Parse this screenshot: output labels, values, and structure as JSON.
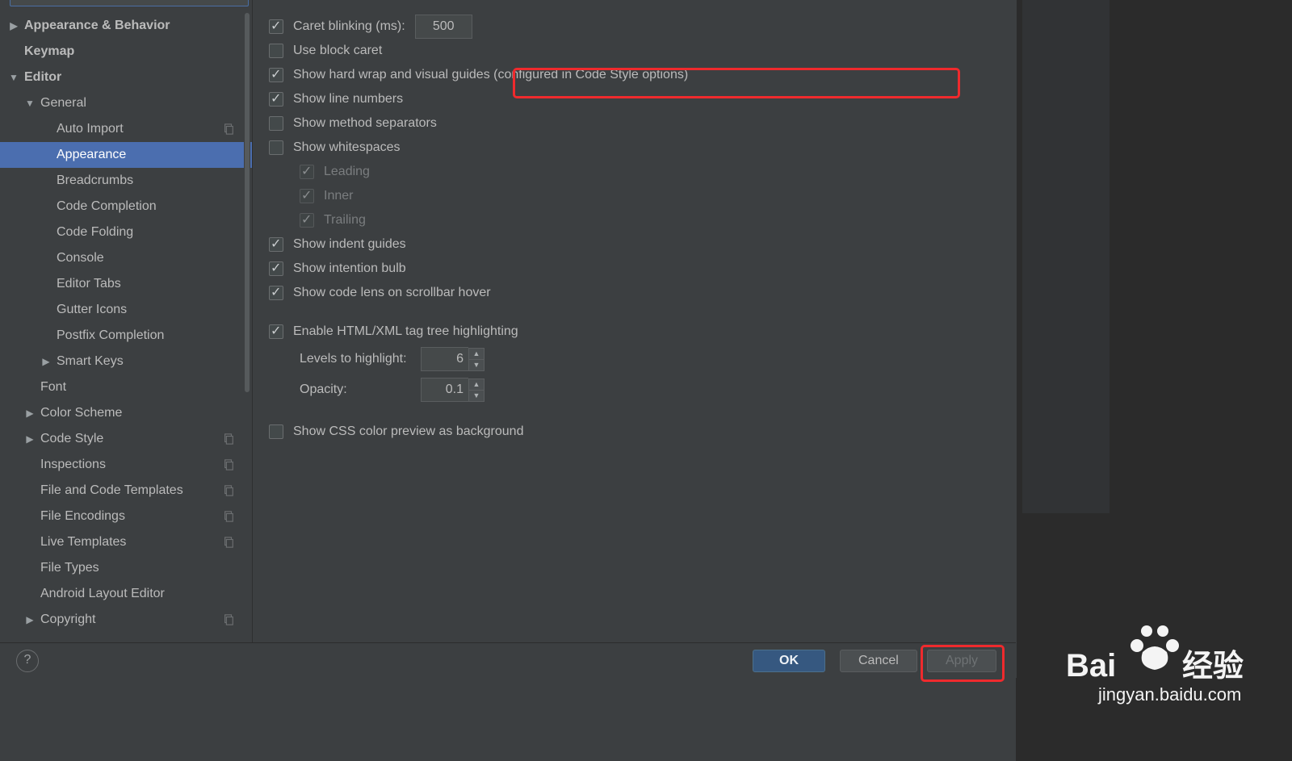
{
  "sidebar": {
    "items": [
      {
        "label": "Appearance & Behavior",
        "arrow": "closed",
        "depth": 0,
        "bold": true
      },
      {
        "label": "Keymap",
        "arrow": "none",
        "depth": 0,
        "bold": true
      },
      {
        "label": "Editor",
        "arrow": "open",
        "depth": 0,
        "bold": true
      },
      {
        "label": "General",
        "arrow": "open",
        "depth": 1,
        "bold": false
      },
      {
        "label": "Auto Import",
        "arrow": "none",
        "depth": 2,
        "copy": true
      },
      {
        "label": "Appearance",
        "arrow": "none",
        "depth": 2,
        "sel": true
      },
      {
        "label": "Breadcrumbs",
        "arrow": "none",
        "depth": 2
      },
      {
        "label": "Code Completion",
        "arrow": "none",
        "depth": 2
      },
      {
        "label": "Code Folding",
        "arrow": "none",
        "depth": 2
      },
      {
        "label": "Console",
        "arrow": "none",
        "depth": 2
      },
      {
        "label": "Editor Tabs",
        "arrow": "none",
        "depth": 2
      },
      {
        "label": "Gutter Icons",
        "arrow": "none",
        "depth": 2
      },
      {
        "label": "Postfix Completion",
        "arrow": "none",
        "depth": 2
      },
      {
        "label": "Smart Keys",
        "arrow": "closed",
        "depth": 2
      },
      {
        "label": "Font",
        "arrow": "none",
        "depth": 1
      },
      {
        "label": "Color Scheme",
        "arrow": "closed",
        "depth": 1
      },
      {
        "label": "Code Style",
        "arrow": "closed",
        "depth": 1,
        "copy": true
      },
      {
        "label": "Inspections",
        "arrow": "none",
        "depth": 1,
        "copy": true
      },
      {
        "label": "File and Code Templates",
        "arrow": "none",
        "depth": 1,
        "copy": true
      },
      {
        "label": "File Encodings",
        "arrow": "none",
        "depth": 1,
        "copy": true
      },
      {
        "label": "Live Templates",
        "arrow": "none",
        "depth": 1,
        "copy": true
      },
      {
        "label": "File Types",
        "arrow": "none",
        "depth": 1
      },
      {
        "label": "Android Layout Editor",
        "arrow": "none",
        "depth": 1
      },
      {
        "label": "Copyright",
        "arrow": "closed",
        "depth": 1,
        "copy": true
      }
    ]
  },
  "main": {
    "caret_blinking_label": "Caret blinking (ms):",
    "caret_blinking_value": "500",
    "use_block_caret": "Use block caret",
    "show_hard_wrap": "Show hard wrap and visual guides (configured in Code Style options)",
    "show_line_numbers": "Show line numbers",
    "show_method_separators": "Show method separators",
    "show_whitespaces": "Show whitespaces",
    "ws_leading": "Leading",
    "ws_inner": "Inner",
    "ws_trailing": "Trailing",
    "show_indent_guides": "Show indent guides",
    "show_intention_bulb": "Show intention bulb",
    "show_code_lens": "Show code lens on scrollbar hover",
    "enable_html_tree": "Enable HTML/XML tag tree highlighting",
    "levels_label": "Levels to highlight:",
    "levels_value": "6",
    "opacity_label": "Opacity:",
    "opacity_value": "0.1",
    "show_css_preview": "Show CSS color preview as background"
  },
  "buttons": {
    "ok": "OK",
    "cancel": "Cancel",
    "apply": "Apply"
  },
  "watermark": {
    "brand": "Bai",
    "brand2": "经验",
    "url": "jingyan.baidu.com"
  }
}
